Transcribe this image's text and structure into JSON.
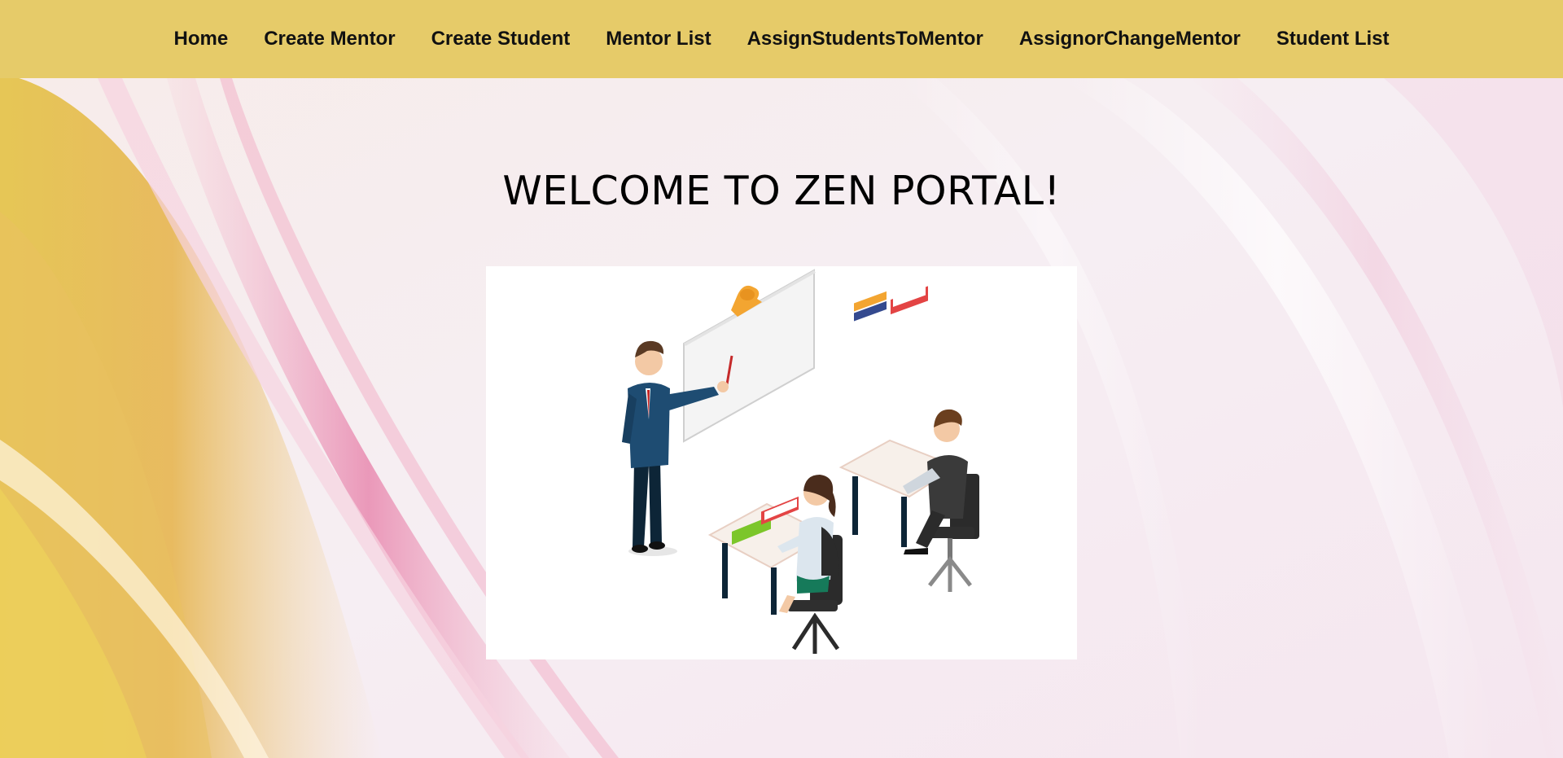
{
  "nav": {
    "items": [
      {
        "label": "Home"
      },
      {
        "label": "Create Mentor"
      },
      {
        "label": "Create Student"
      },
      {
        "label": "Mentor List"
      },
      {
        "label": "AssignStudentsToMentor"
      },
      {
        "label": "AssignorChangeMentor"
      },
      {
        "label": "Student List"
      }
    ]
  },
  "main": {
    "title": "WELCOME TO ZEN PORTAL!"
  },
  "colors": {
    "navbar": "#e6cb69",
    "background": "#f6eef2",
    "accent_yellow": "#e0b84a",
    "accent_pink": "#e9a7c4"
  },
  "illustration": {
    "subject": "classroom-teacher-students-illustration"
  }
}
